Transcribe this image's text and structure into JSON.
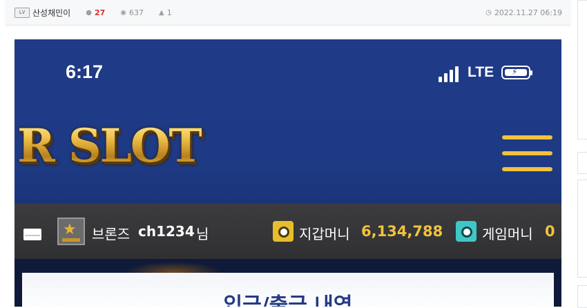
{
  "post": {
    "author_badge": "LV",
    "author": "산성채민이",
    "comments": "27",
    "views": "637",
    "likes": "1",
    "date": "2022.11.27 06:19"
  },
  "screenshot": {
    "status": {
      "time": "6:17",
      "network": "LTE"
    },
    "logo_text": "R SLOT",
    "user": {
      "rank": "브론즈",
      "username": "ch1234",
      "honorific": "님",
      "wallet_label": "지갑머니",
      "wallet_amount": "6,134,788",
      "game_label": "게임머니",
      "game_amount": "0"
    },
    "panel_title": "입금/출금 내역"
  },
  "colors": {
    "header_blue": "#1f3a86",
    "gold": "#f2c23c",
    "user_bar": "#363638"
  },
  "icons": [
    "level-badge-icon",
    "comment-icon",
    "eye-icon",
    "thumbs-up-icon",
    "clock-icon",
    "signal-icon",
    "battery-icon",
    "menu-icon",
    "mail-icon",
    "rank-icon",
    "gold-safe-icon",
    "teal-safe-icon"
  ]
}
